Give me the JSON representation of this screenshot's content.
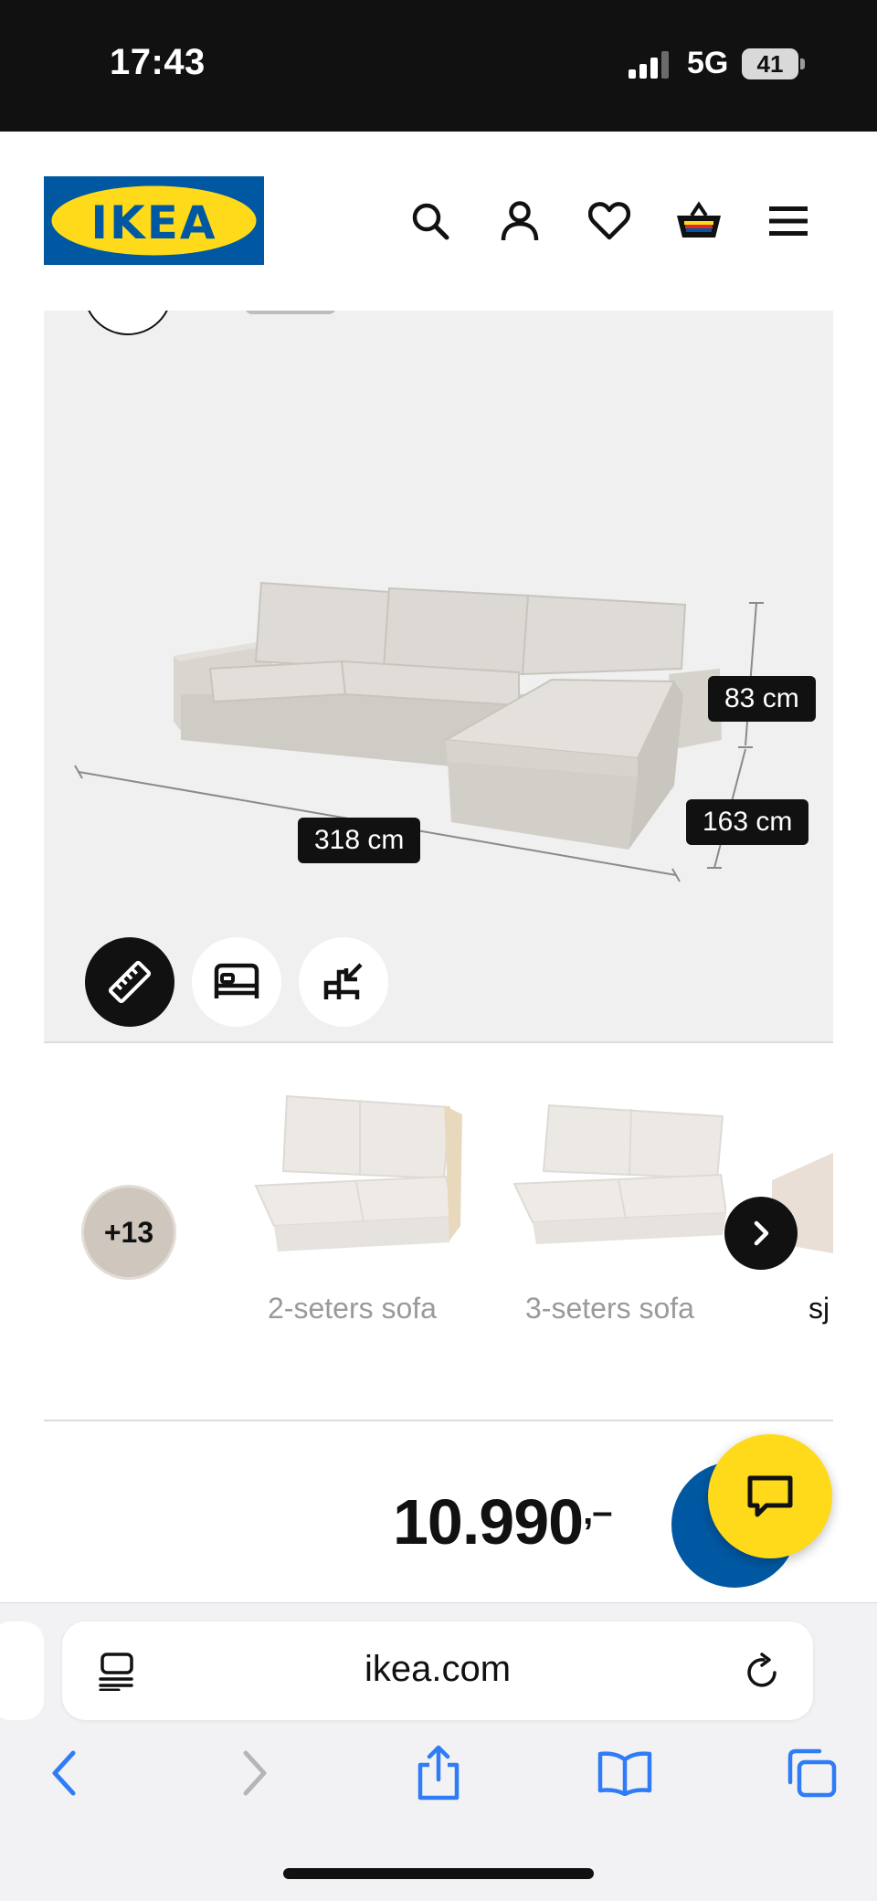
{
  "status_bar": {
    "time": "17:43",
    "network": "5G",
    "battery": "41"
  },
  "header": {
    "logo_text": "IKEA",
    "brand_colors": {
      "blue": "#0058a3",
      "yellow": "#ffda1a"
    },
    "icons": [
      "search-icon",
      "account-icon",
      "heart-icon",
      "cart-icon",
      "menu-icon"
    ]
  },
  "product_image": {
    "dimensions": {
      "height": "83 cm",
      "depth": "163 cm",
      "width": "318 cm"
    },
    "view_buttons": [
      "ruler-icon",
      "bed-icon",
      "convert-icon"
    ]
  },
  "variants": {
    "more_count": "+13",
    "items": [
      {
        "label": "2-seters sofa"
      },
      {
        "label": "3-seters sofa"
      },
      {
        "label": "sj"
      }
    ]
  },
  "price": {
    "amount": "10.990",
    "suffix": ",–"
  },
  "browser": {
    "url": "ikea.com"
  }
}
